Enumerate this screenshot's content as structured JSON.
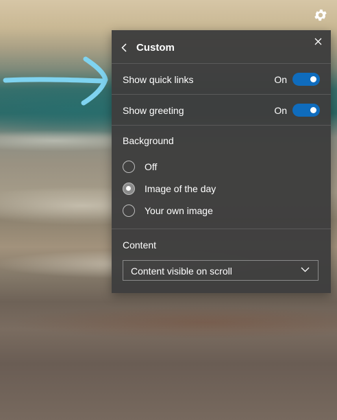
{
  "panel": {
    "title": "Custom",
    "toggles": [
      {
        "label": "Show quick links",
        "state": "On"
      },
      {
        "label": "Show greeting",
        "state": "On"
      }
    ],
    "background": {
      "label": "Background",
      "options": [
        {
          "label": "Off",
          "selected": false
        },
        {
          "label": "Image of the day",
          "selected": true
        },
        {
          "label": "Your own image",
          "selected": false
        }
      ]
    },
    "content": {
      "label": "Content",
      "selected": "Content visible on scroll"
    }
  },
  "colors": {
    "panel_bg": "#3e3e3e",
    "toggle_on": "#0f6cbd",
    "annotation_arrow": "#7fd3f0"
  },
  "icons": [
    "settings-gear-icon",
    "back-chevron-icon",
    "close-icon",
    "dropdown-chevron-icon"
  ]
}
